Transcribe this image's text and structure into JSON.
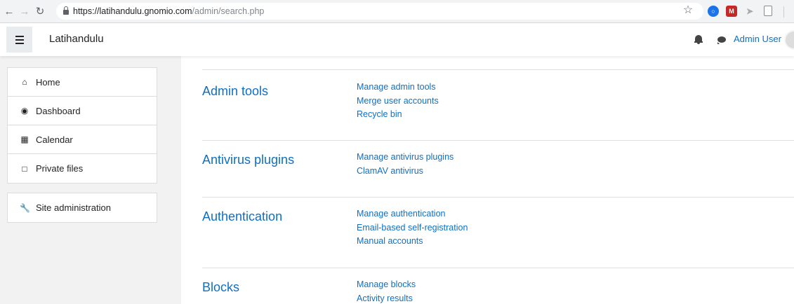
{
  "browser": {
    "url_host": "https://latihandulu.gnomio.com",
    "url_path": "/admin/search.php",
    "back_icon": "arrow-left-icon",
    "forward_icon": "arrow-right-icon",
    "reload_icon": "reload-icon"
  },
  "navbar": {
    "brand": "Latihandulu",
    "user_name": "Admin User"
  },
  "sidebar": {
    "items": [
      {
        "label": "Home",
        "icon": "home-icon"
      },
      {
        "label": "Dashboard",
        "icon": "dashboard-icon"
      },
      {
        "label": "Calendar",
        "icon": "calendar-icon"
      },
      {
        "label": "Private files",
        "icon": "file-icon"
      }
    ],
    "admin": {
      "label": "Site administration",
      "icon": "wrench-icon"
    }
  },
  "sections": [
    {
      "title": "Admin tools",
      "links": [
        "Manage admin tools",
        "Merge user accounts",
        "Recycle bin"
      ]
    },
    {
      "title": "Antivirus plugins",
      "links": [
        "Manage antivirus plugins",
        "ClamAV antivirus"
      ]
    },
    {
      "title": "Authentication",
      "links": [
        "Manage authentication",
        "Email-based self-registration",
        "Manual accounts"
      ]
    },
    {
      "title": "Blocks",
      "links": [
        "Manage blocks",
        "Activity results"
      ]
    }
  ],
  "colors": {
    "link": "#0f6fc5",
    "drawer_bg": "#f2f2f2"
  }
}
